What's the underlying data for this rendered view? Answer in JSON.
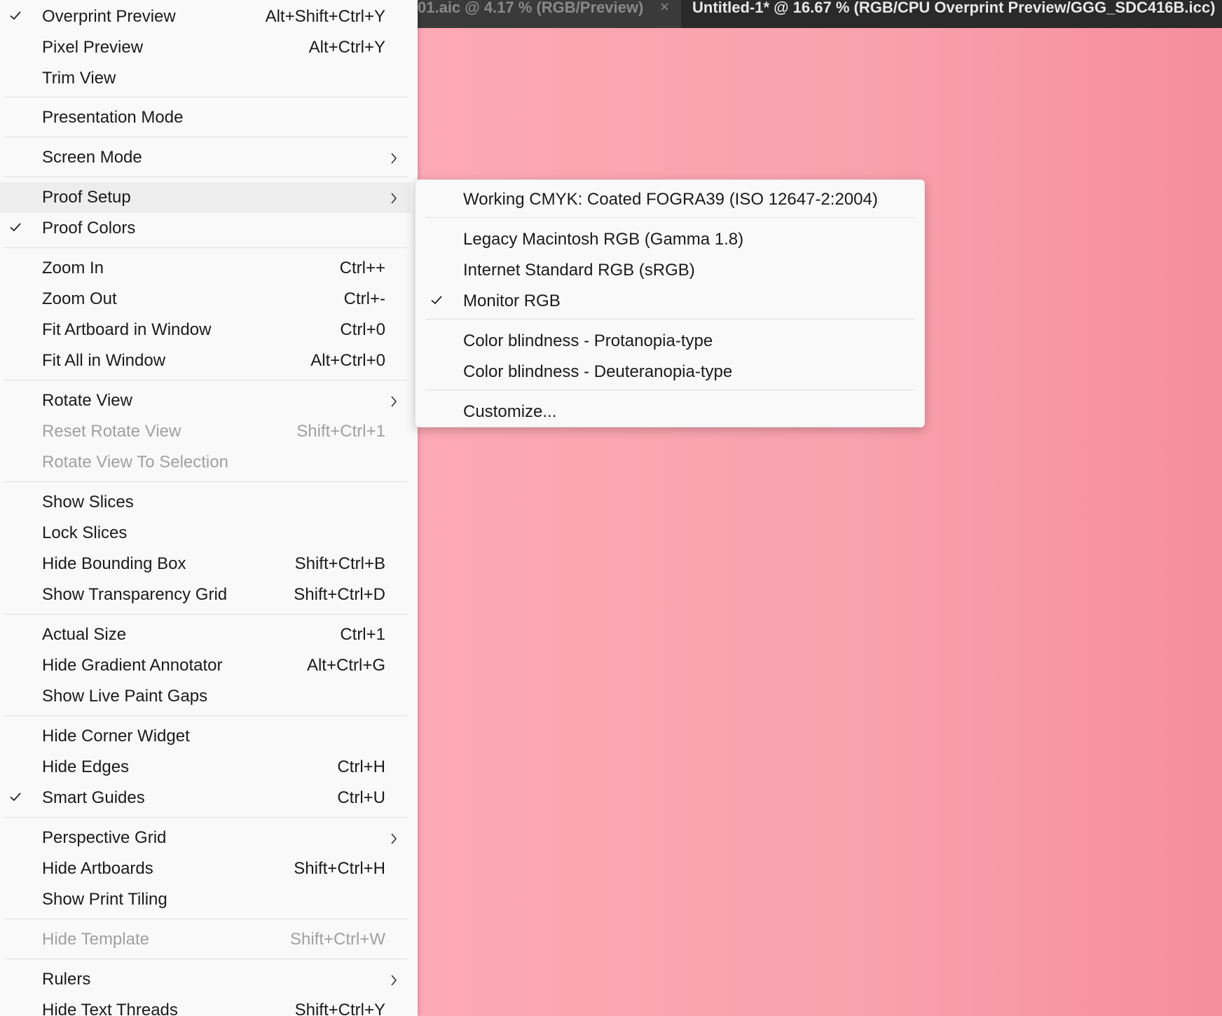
{
  "tabs": {
    "inactive_title": "01.aic @ 4.17 % (RGB/Preview)",
    "close_glyph": "×",
    "active_title": "Untitled-1* @ 16.67 % (RGB/CPU Overprint Preview/GGG_SDC416B.icc)"
  },
  "main_menu": {
    "items": [
      {
        "label": "Overprint Preview",
        "shortcut": "Alt+Shift+Ctrl+Y",
        "checked": true
      },
      {
        "label": "Pixel Preview",
        "shortcut": "Alt+Ctrl+Y"
      },
      {
        "label": "Trim View",
        "shortcut": ""
      },
      {
        "label": "Presentation Mode",
        "shortcut": ""
      },
      {
        "label": "Screen Mode",
        "shortcut": "",
        "submenu": true
      },
      {
        "label": "Proof Setup",
        "shortcut": "",
        "submenu": true,
        "highlighted": true
      },
      {
        "label": "Proof Colors",
        "shortcut": "",
        "checked": true
      },
      {
        "label": "Zoom In",
        "shortcut": "Ctrl++"
      },
      {
        "label": "Zoom Out",
        "shortcut": "Ctrl+-"
      },
      {
        "label": "Fit Artboard in Window",
        "shortcut": "Ctrl+0"
      },
      {
        "label": "Fit All in Window",
        "shortcut": "Alt+Ctrl+0"
      },
      {
        "label": "Rotate View",
        "shortcut": "",
        "submenu": true
      },
      {
        "label": "Reset Rotate View",
        "shortcut": "Shift+Ctrl+1",
        "disabled": true
      },
      {
        "label": "Rotate View To Selection",
        "shortcut": "",
        "disabled": true
      },
      {
        "label": "Show Slices",
        "shortcut": ""
      },
      {
        "label": "Lock Slices",
        "shortcut": ""
      },
      {
        "label": "Hide Bounding Box",
        "shortcut": "Shift+Ctrl+B"
      },
      {
        "label": "Show Transparency Grid",
        "shortcut": "Shift+Ctrl+D"
      },
      {
        "label": "Actual Size",
        "shortcut": "Ctrl+1"
      },
      {
        "label": "Hide Gradient Annotator",
        "shortcut": "Alt+Ctrl+G"
      },
      {
        "label": "Show Live Paint Gaps",
        "shortcut": ""
      },
      {
        "label": "Hide Corner Widget",
        "shortcut": ""
      },
      {
        "label": "Hide Edges",
        "shortcut": "Ctrl+H"
      },
      {
        "label": "Smart Guides",
        "shortcut": "Ctrl+U",
        "checked": true
      },
      {
        "label": "Perspective Grid",
        "shortcut": "",
        "submenu": true
      },
      {
        "label": "Hide Artboards",
        "shortcut": "Shift+Ctrl+H"
      },
      {
        "label": "Show Print Tiling",
        "shortcut": ""
      },
      {
        "label": "Hide Template",
        "shortcut": "Shift+Ctrl+W",
        "disabled": true
      },
      {
        "label": "Rulers",
        "shortcut": "",
        "submenu": true
      },
      {
        "label": "Hide Text Threads",
        "shortcut": "Shift+Ctrl+Y"
      }
    ]
  },
  "proof_setup_submenu": {
    "items": [
      {
        "label": "Working CMYK: Coated FOGRA39 (ISO 12647-2:2004)"
      },
      {
        "label": "Legacy Macintosh RGB (Gamma 1.8)"
      },
      {
        "label": "Internet Standard RGB (sRGB)"
      },
      {
        "label": "Monitor RGB",
        "checked": true
      },
      {
        "label": "Color blindness - Protanopia-type"
      },
      {
        "label": "Color blindness - Deuteranopia-type"
      },
      {
        "label": "Customize..."
      }
    ]
  },
  "colors": {
    "menu_bg": "#f9f9f9",
    "canvas_left": "#fda9b5",
    "canvas_right": "#f68d9f",
    "tabbar": "#323232"
  }
}
